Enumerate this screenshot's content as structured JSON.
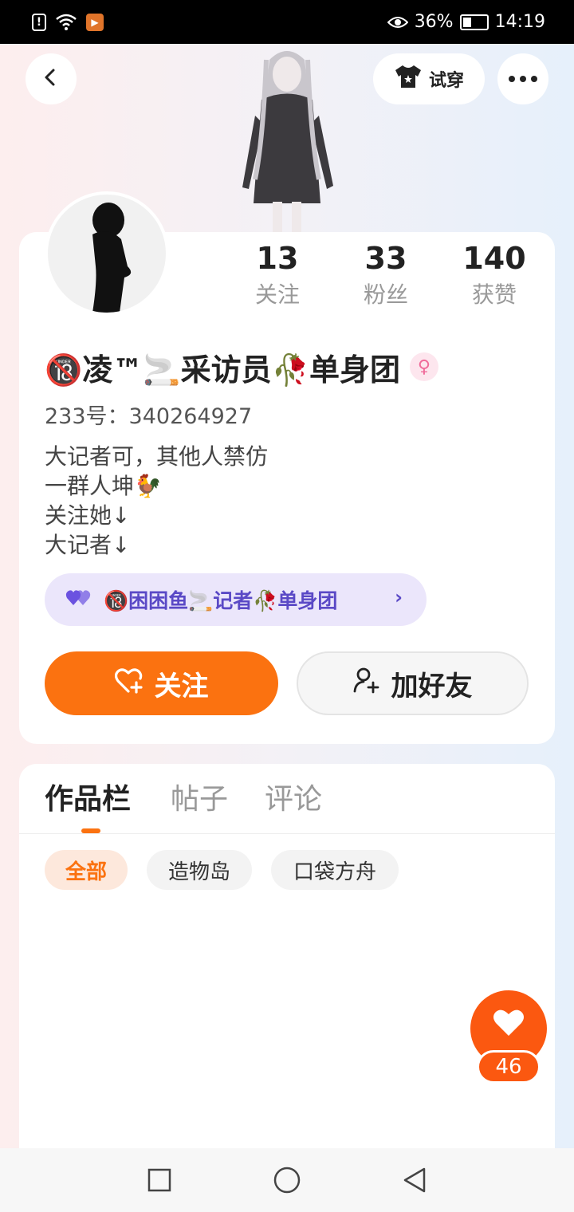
{
  "status_bar": {
    "battery": "36%",
    "battery_level": 0.36,
    "time": "14:19",
    "left_icons": [
      "alert-icon",
      "wifi-icon",
      "app-notification-icon"
    ],
    "right_icons": [
      "eye-icon",
      "battery-icon"
    ]
  },
  "top_bar": {
    "back_icon": "chevron-left-icon",
    "try_on_label": "试穿",
    "more_icon": "more-dots-icon"
  },
  "profile": {
    "stats": [
      {
        "value": "13",
        "label": "关注"
      },
      {
        "value": "33",
        "label": "粉丝"
      },
      {
        "value": "140",
        "label": "获赞"
      }
    ],
    "nickname": "🔞凌™🚬采访员🥀单身团",
    "gender_icon": "♀",
    "uid": "233号：340264927",
    "bio_lines": [
      "大记者可，其他人禁仿",
      "一群人坤🐓",
      "关注她↓",
      "大记者↓"
    ],
    "group_label": "🔞困困鱼🚬记者🥀单身团",
    "group_chevron": "›",
    "follow_label": "关注",
    "add_friend_label": "加好友"
  },
  "works": {
    "tabs": [
      {
        "label": "作品栏",
        "active": true
      },
      {
        "label": "帖子",
        "active": false
      },
      {
        "label": "评论",
        "active": false
      }
    ],
    "chips": [
      {
        "label": "全部",
        "active": true
      },
      {
        "label": "造物岛",
        "active": false
      },
      {
        "label": "口袋方舟",
        "active": false
      }
    ]
  },
  "like_fab": {
    "count": "46"
  },
  "nav_bar": {
    "icons": [
      "recent-apps-icon",
      "home-icon",
      "back-nav-icon"
    ]
  },
  "colors": {
    "accent": "#fb7210",
    "group_pill_bg": "#ebe6fb",
    "group_pill_text": "#5a49c6"
  }
}
